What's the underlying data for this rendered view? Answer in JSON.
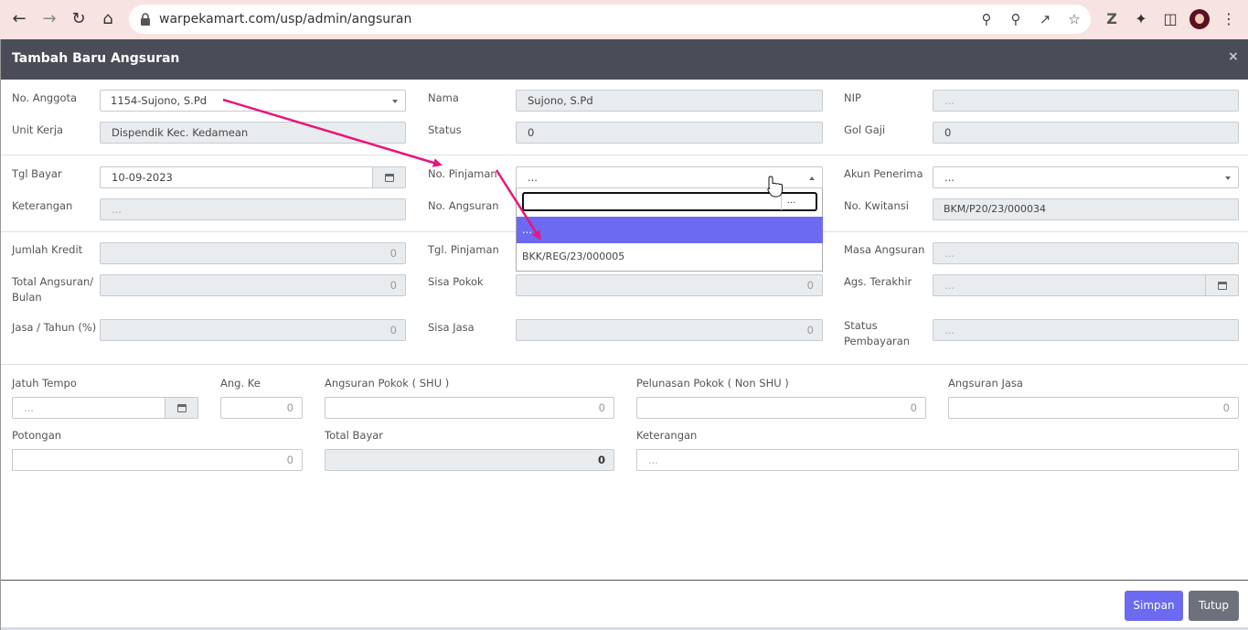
{
  "browser": {
    "url": "warpekamart.com/usp/admin/angsuran"
  },
  "modal": {
    "title": "Tambah Baru Angsuran",
    "close": "×"
  },
  "form": {
    "no_anggota_label": "No. Anggota",
    "no_anggota_value": "1154-Sujono, S.Pd",
    "nama_label": "Nama",
    "nama_value": "Sujono, S.Pd",
    "nip_label": "NIP",
    "nip_value": "...",
    "unit_kerja_label": "Unit Kerja",
    "unit_kerja_value": "Dispendik Kec. Kedamean",
    "status_label": "Status",
    "status_value": "0",
    "gol_gaji_label": "Gol Gaji",
    "gol_gaji_value": "0",
    "tgl_bayar_label": "Tgl Bayar",
    "tgl_bayar_value": "10-09-2023",
    "no_pinjaman_label": "No. Pinjaman",
    "no_pinjaman_value": "...",
    "akun_penerima_label": "Akun Penerima",
    "akun_penerima_value": "...",
    "keterangan_label": "Keterangan",
    "keterangan_value": "...",
    "no_angsuran_label": "No. Angsuran",
    "no_kwitansi_label": "No. Kwitansi",
    "no_kwitansi_value": "BKM/P20/23/000034",
    "jumlah_kredit_label": "Jumlah Kredit",
    "jumlah_kredit_value": "0",
    "tgl_pinjaman_label": "Tgl. Pinjaman",
    "masa_angsuran_label": "Masa Angsuran",
    "masa_angsuran_value": "...",
    "total_angsuran_label_1": "Total Angsuran/",
    "total_angsuran_label_2": "Bulan",
    "total_angsuran_value": "0",
    "sisa_pokok_label": "Sisa Pokok",
    "sisa_pokok_value": "0",
    "ags_terakhir_label": "Ags. Terakhir",
    "ags_terakhir_value": "...",
    "jasa_tahun_label": "Jasa / Tahun (%)",
    "jasa_tahun_value": "0",
    "sisa_jasa_label": "Sisa Jasa",
    "sisa_jasa_value": "0",
    "status_pembayaran_label_1": "Status",
    "status_pembayaran_label_2": "Pembayaran",
    "status_pembayaran_value": "...",
    "jatuh_tempo_label": "Jatuh Tempo",
    "jatuh_tempo_value": "...",
    "ang_ke_label": "Ang. Ke",
    "ang_ke_value": "0",
    "angsuran_pokok_label": "Angsuran Pokok ( SHU )",
    "angsuran_pokok_value": "0",
    "pelunasan_pokok_label": "Pelunasan Pokok ( Non SHU )",
    "pelunasan_pokok_value": "0",
    "angsuran_jasa_label": "Angsuran Jasa",
    "angsuran_jasa_value": "0",
    "potongan_label": "Potongan",
    "potongan_value": "0",
    "total_bayar_label": "Total Bayar",
    "total_bayar_value": "0",
    "keterangan2_label": "Keterangan",
    "keterangan2_value": "..."
  },
  "dropdown": {
    "search_button": "...",
    "options": [
      "...",
      "BKK/REG/23/000005"
    ]
  },
  "buttons": {
    "simpan": "Simpan",
    "tutup": "Tutup"
  },
  "colors": {
    "header": "#4a4d57",
    "primary": "#6b6af0",
    "secondary": "#6c717b",
    "annotation_arrow": "#e8157a"
  }
}
